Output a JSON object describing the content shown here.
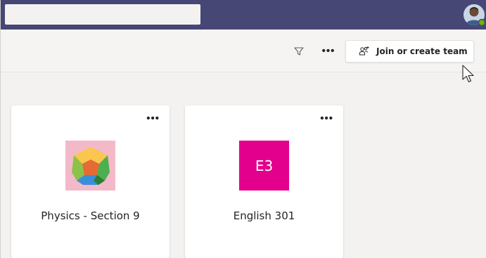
{
  "header": {
    "search_placeholder": "",
    "avatar_icon": "user-avatar",
    "presence_color": "#6bb700",
    "bar_color": "#464775"
  },
  "toolbar": {
    "filter_icon": "filter-icon",
    "more_label": "•••",
    "join_button_label": "Join or create team",
    "join_icon": "people-add-icon"
  },
  "teams": [
    {
      "name": "Physics - Section 9",
      "tile_type": "image",
      "tile_icon": "dodecahedron-icon",
      "tile_color": "#f4b9c9",
      "more_label": "•••"
    },
    {
      "name": "English 301",
      "tile_type": "initials",
      "initials": "E3",
      "tile_color": "#e3008c",
      "more_label": "•••"
    }
  ]
}
